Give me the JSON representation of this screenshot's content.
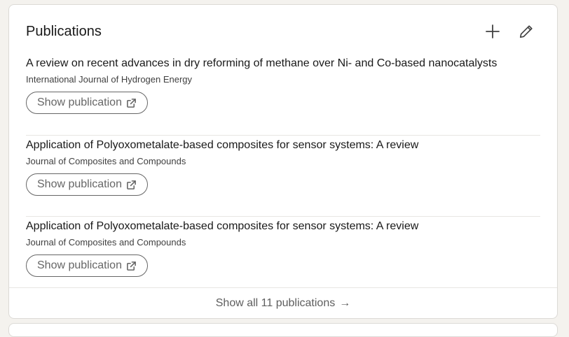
{
  "section": {
    "title": "Publications",
    "add_icon": "plus-icon",
    "edit_icon": "pencil-icon"
  },
  "publications": [
    {
      "title": "A review on recent advances in dry reforming of methane over Ni- and Co-based nanocatalysts",
      "source": "International Journal of Hydrogen Energy",
      "button_label": "Show publication"
    },
    {
      "title": "Application of Polyoxometalate-based composites for sensor systems: A review",
      "source": "Journal of Composites and Compounds",
      "button_label": "Show publication"
    },
    {
      "title": "Application of Polyoxometalate-based composites for sensor systems: A review",
      "source": "Journal of Composites and Compounds",
      "button_label": "Show publication"
    }
  ],
  "footer": {
    "label": "Show all 11 publications",
    "arrow": "→"
  },
  "colors": {
    "text": "#191919",
    "muted": "#666666",
    "divider": "#e8e6e3"
  }
}
